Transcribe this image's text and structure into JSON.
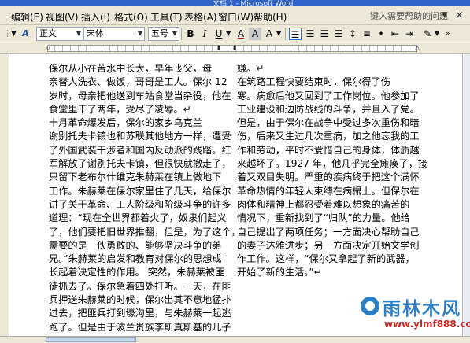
{
  "window": {
    "title": "文档 1 - Microsoft Word"
  },
  "menubar": {
    "items": [
      {
        "label": "编辑(E)"
      },
      {
        "label": "视图(V)"
      },
      {
        "label": "插入(I)"
      },
      {
        "label": "格式(O)"
      },
      {
        "label": "工具(T)"
      },
      {
        "label": "表格(A)"
      },
      {
        "label": "窗口(W)"
      },
      {
        "label": "帮助(H)"
      }
    ],
    "help_placeholder": "键入需要帮助的问题",
    "close_glyph": "×"
  },
  "toolbar": {
    "style_icon": "A",
    "style_value": "正文",
    "font_value": "宋体",
    "size_value": "五号",
    "bold": "B",
    "italic": "I",
    "underline": "U",
    "font_color": "A",
    "char_shade": "A",
    "char_scale": "A"
  },
  "document": {
    "left_column": [
      "    保尔从小在苦水中长大，早年丧父，母",
      "亲替人洗衣、做饭，哥哥是工人。保尔 12",
      "岁时，母亲把他送到车站食堂当杂役，他在",
      "食堂里干了两年，受尽了凌辱。↵",
      "    十月革命爆发后，保尔的家乡乌克兰",
      "谢别托夫卡镇也和苏联其他地方一样，遭受",
      "了外国武装干涉者和国内反动派的践踏。红",
      "军解放了谢别托夫卡镇，但很快就撤走了，",
      "只留下老布尔什维克朱赫莱在镇上做地下",
      "工作。朱赫莱在保尔家里住了几天，给保尔",
      "讲了关于革命、工人阶级和阶级斗争的许多",
      "道理：“现在全世界都着火了，奴隶们起义",
      "了，他们要把旧世界推翻，但是，为了这个，",
      "需要的是一伙勇敢的、能够坚决斗争的弟",
      "兄。”朱赫莱的启发和教育对保尔的思想成",
      "长起着决定性的作用。  突然，朱赫莱被匪",
      "徒抓去了。保尔急着四处打听。一天，在匪",
      "兵押送朱赫莱的时候，保尔出其不意地猛扑",
      "过去，把匪兵打到壕沟里，与朱赫莱一起逃",
      "跑了。但是由于波兰贵族李斯真斯基的儿子"
    ],
    "right_column": [
      "嫌。↵",
      "    在筑路工程快要结束时，保尔得了伤",
      "寒。病愈后他又回到了工作岗位。他参加了",
      "工业建设和边防战线的斗争，并且入了党。",
      "但是，由于保尔在战争中受过多次重伤和暗",
      "伤，后来又生过几次重病，加之他忘我的工",
      "作和劳动，平时不爱惜自己的身体，体质越",
      "来越坏了。1927 年，他几乎完全瘫痪了，接",
      "着又双目失明。严重的疾病终于把这个满怀",
      "革命热情的年轻人束缚在病榻上。但保尔在",
      "肉体和精神上都忍受着难以想象的痛苦的",
      "情况下，重新找到了“归队”的力量。他给",
      "自己提出了两项任务；一方面决心帮助自己",
      "的妻子达雅进步；另一方面决定开始文学创",
      "作工作。这样，“保尔又拿起了新的武器，",
      "开始了新的生活。”↵"
    ]
  },
  "watermark": {
    "title": "雨林木风",
    "url": "www.ylmf888.com"
  }
}
